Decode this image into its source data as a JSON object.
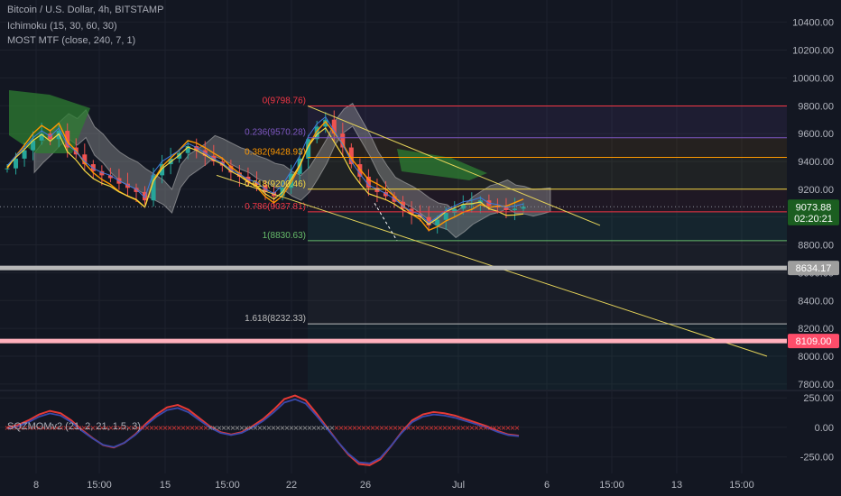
{
  "header": {
    "symbol_title": "Bitcoin / U.S. Dollar, 4h, BITSTAMP",
    "ichimoku_label": "Ichimoku (15, 30, 60, 30)",
    "most_label": "MOST MTF (close, 240, 7, 1)",
    "sqz_label": "SQZMOMv2 (21, 2, 21, 1.5, 3)"
  },
  "colors": {
    "background": "#131722",
    "grid": "#1e222d",
    "axis_text": "#b2b5be",
    "up_candle": "#26a69a",
    "down_candle": "#ef5350",
    "trendline": "#e6d45a",
    "most_line": "#ff9800",
    "kumo_bull": "#1b5e20",
    "kumo_bear": "#b0b0b0"
  },
  "chart_data": [
    {
      "type": "candlestick",
      "title": "Bitcoin / U.S. Dollar, 4h, BITSTAMP",
      "y_axis_ticks": [
        10400,
        10200,
        10000,
        9800,
        9600,
        9400,
        9200,
        9000,
        8800,
        8600,
        8400,
        8200,
        8000,
        7800
      ],
      "y_axis_tick_labels": [
        "10400.00",
        "10200.00",
        "10000.00",
        "9800.00",
        "9600.00",
        "9400.00",
        "9200.00",
        "9000.00",
        "8800.00",
        "8600.00",
        "8400.00",
        "8200.00",
        "8000.00",
        "7800.00"
      ],
      "ylim": [
        7760,
        10560
      ],
      "x_axis_labels": [
        "8",
        "15:00",
        "15",
        "15:00",
        "22",
        "26",
        "Jul",
        "6",
        "15:00",
        "13",
        "15:00"
      ],
      "price_tags": [
        {
          "label": "9073.88",
          "value": 9073.88,
          "color": "#1b5e20"
        },
        {
          "label": "02:20:21",
          "value": 8992,
          "color": "#1b5e20"
        },
        {
          "label": "8634.17",
          "value": 8634.17,
          "color": "#9e9e9e"
        },
        {
          "label": "8109.00",
          "value": 8109.0,
          "color": "#ff4d6a"
        }
      ],
      "horizontal_levels": [
        {
          "value": 8634.17,
          "color": "#b8b8b8"
        },
        {
          "value": 8109.0,
          "color": "#ffb0bc"
        }
      ],
      "fibonacci": [
        {
          "label": "0(9798.76)",
          "value": 9798.76,
          "color": "#f23645"
        },
        {
          "label": "0.236(9570.28)",
          "value": 9570.28,
          "color": "#7e57c2"
        },
        {
          "label": "0.382(9428.93)",
          "value": 9428.93,
          "color": "#ff9800"
        },
        {
          "label": "0.618(9200.46)",
          "value": 9200.46,
          "color": "#f5d742"
        },
        {
          "label": "0.786(9037.81)",
          "value": 9037.81,
          "color": "#f23645"
        },
        {
          "label": "1(8830.63)",
          "value": 8830.63,
          "color": "#66bb6a"
        },
        {
          "label": "1.618(8232.33)",
          "value": 8232.33,
          "color": "#bdbdbd"
        }
      ],
      "closes": [
        9350,
        9420,
        9480,
        9550,
        9600,
        9560,
        9620,
        9500,
        9450,
        9380,
        9330,
        9300,
        9280,
        9240,
        9210,
        9180,
        9120,
        9300,
        9380,
        9420,
        9460,
        9510,
        9480,
        9440,
        9400,
        9370,
        9320,
        9290,
        9250,
        9230,
        9180,
        9150,
        9210,
        9310,
        9420,
        9560,
        9650,
        9700,
        9600,
        9500,
        9380,
        9290,
        9210,
        9180,
        9150,
        9110,
        9060,
        9020,
        9000,
        8940,
        8980,
        9030,
        9060,
        9090,
        9100,
        9120,
        9080,
        9070,
        9050,
        9060,
        9073.88
      ]
    },
    {
      "type": "line",
      "title": "SQZMOMv2 (21, 2, 21, 1.5, 3)",
      "y_axis_ticks": [
        250,
        0,
        -250
      ],
      "y_axis_tick_labels": [
        "250.00",
        "0.00",
        "-250.00"
      ],
      "ylim": [
        -390,
        305
      ],
      "series": [
        {
          "values": [
            0,
            20,
            60,
            110,
            140,
            120,
            60,
            -20,
            -90,
            -150,
            -170,
            -130,
            -60,
            30,
            110,
            170,
            190,
            150,
            80,
            10,
            -40,
            -60,
            -40,
            10,
            70,
            150,
            240,
            270,
            230,
            120,
            0,
            -120,
            -230,
            -310,
            -320,
            -270,
            -160,
            -40,
            60,
            110,
            130,
            120,
            100,
            70,
            40,
            10,
            -30,
            -60,
            -70
          ]
        }
      ]
    }
  ]
}
